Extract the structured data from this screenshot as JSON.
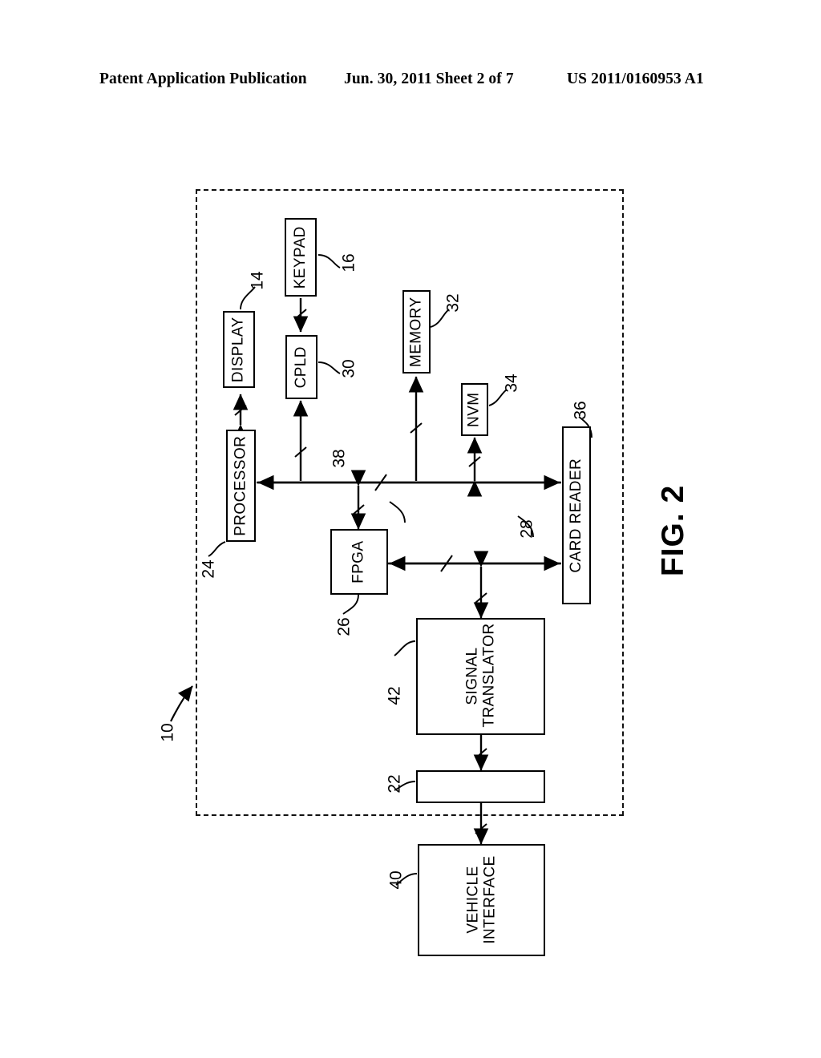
{
  "header": {
    "publication": "Patent Application Publication",
    "date_sheet": "Jun. 30, 2011  Sheet 2 of 7",
    "patent_number": "US 2011/0160953 A1"
  },
  "figure": {
    "title": "FIG. 2",
    "system_ref": "10",
    "blocks": [
      {
        "id": "display",
        "label": "DISPLAY",
        "ref": "14"
      },
      {
        "id": "keypad",
        "label": "KEYPAD",
        "ref": "16"
      },
      {
        "id": "cpld",
        "label": "CPLD",
        "ref": "30"
      },
      {
        "id": "memory",
        "label": "MEMORY",
        "ref": "32"
      },
      {
        "id": "nvm",
        "label": "NVM",
        "ref": "34"
      },
      {
        "id": "processor",
        "label": "PROCESSOR",
        "ref": "24"
      },
      {
        "id": "fpga",
        "label": "FPGA",
        "ref": "26"
      },
      {
        "id": "card-reader",
        "label": "CARD READER",
        "ref": "36"
      },
      {
        "id": "signal-translator",
        "label": "SIGNAL TRANSLATOR",
        "ref": "42"
      },
      {
        "id": "connector",
        "label": "",
        "ref": "22"
      },
      {
        "id": "vehicle-interface",
        "label": "VEHICLE INTERFACE",
        "ref": "40"
      }
    ],
    "buses": [
      {
        "id": "main-bus",
        "ref": "38"
      },
      {
        "id": "secondary-bus",
        "ref": "28"
      }
    ]
  },
  "colors": {
    "ink": "#000000",
    "paper": "#ffffff"
  }
}
